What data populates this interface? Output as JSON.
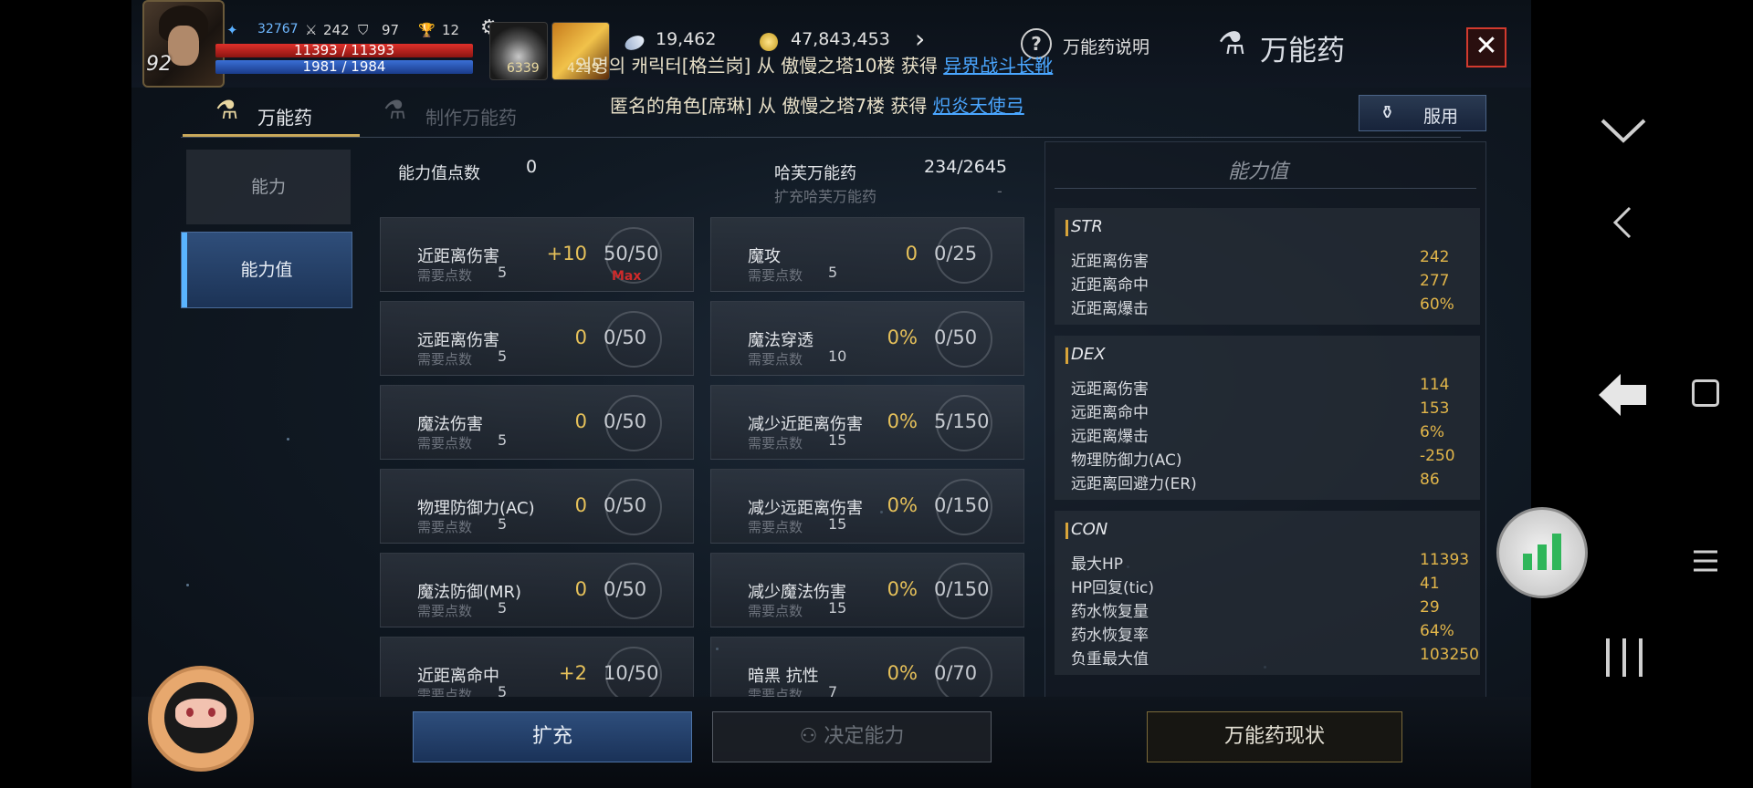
{
  "player": {
    "level": "92",
    "power": "32767",
    "str": "242",
    "def": "97",
    "trophy": "12",
    "hp": "11393 / 11393",
    "mp": "1981 / 1984"
  },
  "items": {
    "potion_count": "6339",
    "item2_count": "4259"
  },
  "currency": {
    "gems": "19,462",
    "gold": "47,843,453"
  },
  "header": {
    "help_label": "万能药说明",
    "title": "万能药",
    "close_label": "✕"
  },
  "marquee": {
    "line1_prefix": "익명의 캐릭터[格兰岗] 从 傲慢之塔10楼 获得",
    "line1_item": "异界战斗长靴",
    "line2_prefix": "匿名的角色[席琳] 从 傲慢之塔7楼 获得",
    "line2_item": "炽炎天使弓"
  },
  "tabs": [
    {
      "label": "万能药",
      "active": true
    },
    {
      "label": "制作万能药",
      "active": false
    }
  ],
  "take_button": "服用",
  "sidenav": [
    {
      "label": "能力",
      "active": false
    },
    {
      "label": "能力值",
      "active": true
    }
  ],
  "summary": {
    "points_label": "能力值点数",
    "points_value": "0",
    "elixir_label": "哈芙万能药",
    "elixir_value": "234/2645",
    "expand_label": "扩充哈芙万能药",
    "expand_value": "-"
  },
  "req_label": "需要点数",
  "max_label": "Max",
  "left_cells": [
    {
      "name": "近距离伤害",
      "bonus": "+10",
      "progress": "50/50",
      "req": "5",
      "max": true
    },
    {
      "name": "远距离伤害",
      "bonus": "0",
      "progress": "0/50",
      "req": "5",
      "max": false
    },
    {
      "name": "魔法伤害",
      "bonus": "0",
      "progress": "0/50",
      "req": "5",
      "max": false
    },
    {
      "name": "物理防御力(AC)",
      "bonus": "0",
      "progress": "0/50",
      "req": "5",
      "max": false
    },
    {
      "name": "魔法防御(MR)",
      "bonus": "0",
      "progress": "0/50",
      "req": "5",
      "max": false
    },
    {
      "name": "近距离命中",
      "bonus": "+2",
      "progress": "10/50",
      "req": "5",
      "max": false
    }
  ],
  "right_cells": [
    {
      "name": "魔攻",
      "bonus": "0",
      "progress": "0/25",
      "req": "5"
    },
    {
      "name": "魔法穿透",
      "bonus": "0%",
      "progress": "0/50",
      "req": "10"
    },
    {
      "name": "减少近距离伤害",
      "bonus": "0%",
      "progress": "5/150",
      "req": "15"
    },
    {
      "name": "减少远距离伤害",
      "bonus": "0%",
      "progress": "0/150",
      "req": "15"
    },
    {
      "name": "减少魔法伤害",
      "bonus": "0%",
      "progress": "0/150",
      "req": "15"
    },
    {
      "name": "暗黑 抗性",
      "bonus": "0%",
      "progress": "0/70",
      "req": "7"
    }
  ],
  "stats_panel": {
    "title": "能力值",
    "sections": [
      {
        "head": "STR",
        "rows": [
          {
            "label": "近距离伤害",
            "value": "242"
          },
          {
            "label": "近距离命中",
            "value": "277"
          },
          {
            "label": "近距离爆击",
            "value": "60%"
          }
        ]
      },
      {
        "head": "DEX",
        "rows": [
          {
            "label": "远距离伤害",
            "value": "114"
          },
          {
            "label": "远距离命中",
            "value": "153"
          },
          {
            "label": "远距离爆击",
            "value": "6%"
          },
          {
            "label": "物理防御力(AC)",
            "value": "-250"
          },
          {
            "label": "远距离回避力(ER)",
            "value": "86"
          }
        ]
      },
      {
        "head": "CON",
        "rows": [
          {
            "label": "最大HP",
            "value": "11393"
          },
          {
            "label": "HP回复(tic)",
            "value": "41"
          },
          {
            "label": "药水恢复量",
            "value": "29"
          },
          {
            "label": "药水恢复率",
            "value": "64%"
          },
          {
            "label": "负重最大值",
            "value": "103250"
          }
        ]
      }
    ]
  },
  "bottom": {
    "expand_button": "扩充",
    "decide_button": "决定能力",
    "status_button": "万能药现状"
  },
  "colors": {
    "accent_gold": "#e6c15a",
    "hp_red": "#e0302a",
    "mp_blue": "#3a6fd6",
    "link_blue": "#4aa6ff",
    "max_red": "#d02a2a"
  },
  "icons": [
    "chevron-down-icon",
    "back-icon",
    "home-icon",
    "menu-icon",
    "recents-icon",
    "signal-bars-icon"
  ]
}
